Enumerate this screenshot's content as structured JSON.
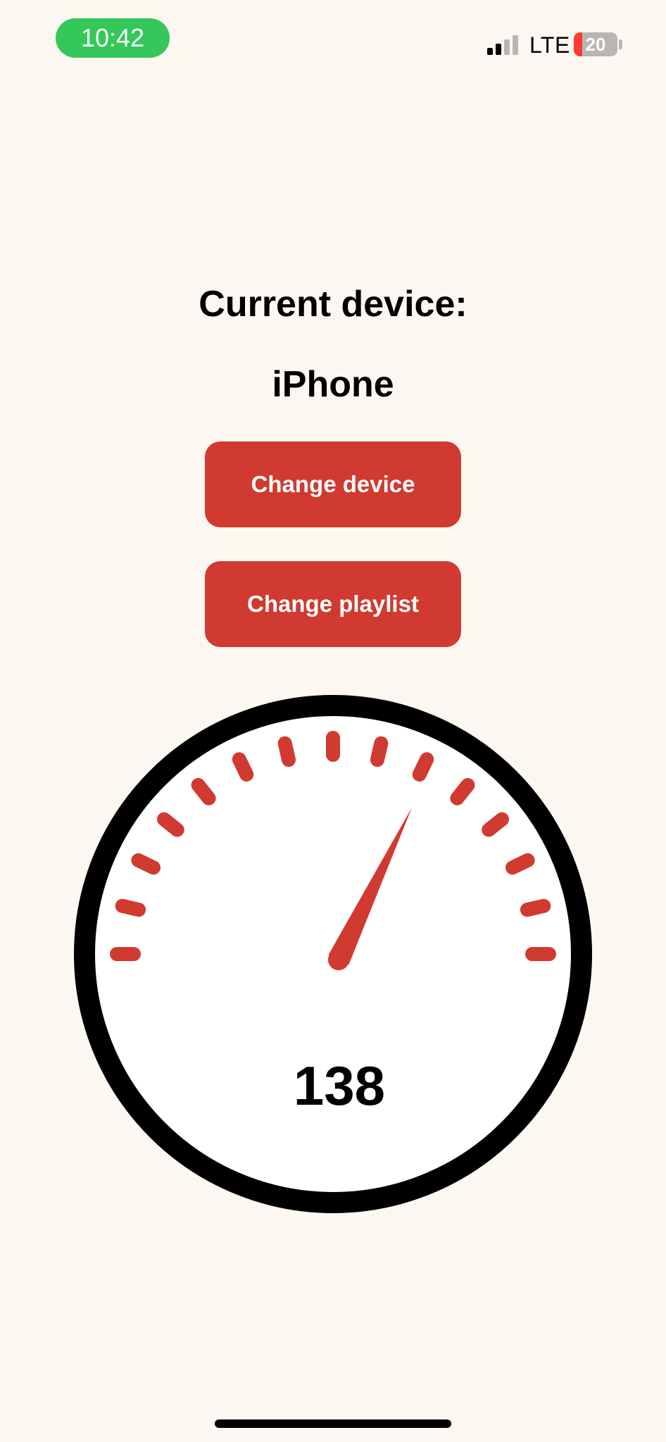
{
  "status_bar": {
    "time": "10:42",
    "time_pill_color": "#34c759",
    "network": "LTE",
    "signal_bars_active": 2,
    "signal_bars_total": 4,
    "battery_level": "20",
    "battery_fraction": 0.2
  },
  "main": {
    "device_label": "Current device:",
    "device_name": "iPhone",
    "change_device_label": "Change device",
    "change_playlist_label": "Change playlist",
    "accent_color": "#d13a30"
  },
  "gauge": {
    "value": "138",
    "tick_count": 15,
    "needle_tick_index": 9
  }
}
